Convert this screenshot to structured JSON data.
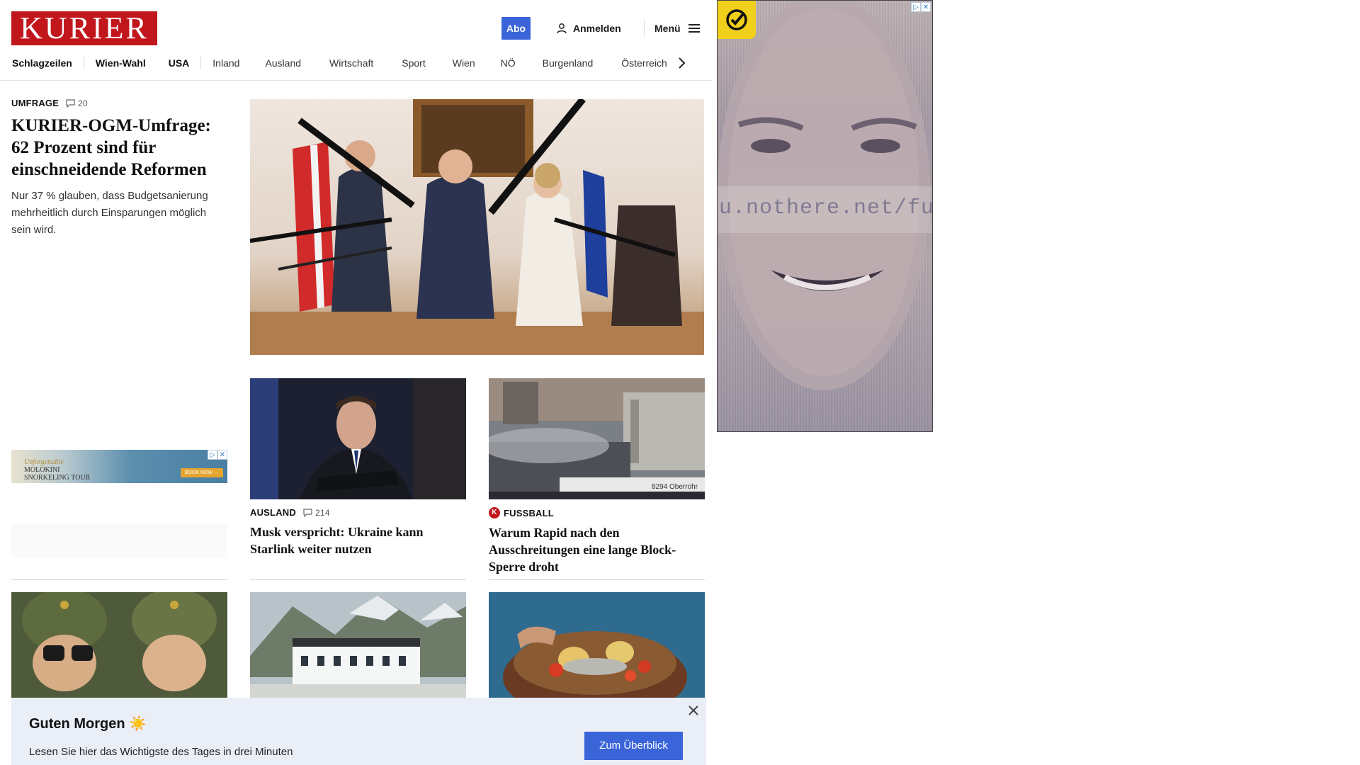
{
  "header": {
    "logo": "KURIER",
    "abo_label": "Abo",
    "login_label": "Anmelden",
    "menu_label": "Menü"
  },
  "nav": {
    "items": [
      "Schlagzeilen",
      "Wien-Wahl",
      "USA",
      "Inland",
      "Ausland",
      "Wirtschaft",
      "Sport",
      "Wien",
      "NÖ",
      "Burgenland",
      "Österreich"
    ]
  },
  "lead": {
    "kicker": "UMFRAGE",
    "comments": "20",
    "title": "KURIER-OGM-Umfrage: 62 Prozent sind für einschneidende Reformen",
    "teaser": "Nur 37 % glauben, dass Budgetsanierung mehrheitlich durch Einsparungen möglich sein wird."
  },
  "small_ad": {
    "line1": "Unforgettable",
    "line2": "MOLOKINI",
    "line3": "SNORKELING TOUR",
    "cta": "BOOK NOW →"
  },
  "cards": [
    {
      "kicker": "AUSLAND",
      "comments": "214",
      "title": "Musk verspricht: Ukraine kann Starlink weiter nutzen"
    },
    {
      "kicker": "FUSSBALL",
      "title": "Warum Rapid nach den Ausschreitungen eine lange Block-Sperre droht"
    }
  ],
  "side_ad": {
    "watermark": "u.nothere.net/fu"
  },
  "banner": {
    "title": "Guten Morgen ☀️",
    "text": "Lesen Sie hier das Wichtigste des Tages in drei Minuten",
    "cta": "Zum Überblick"
  },
  "colors": {
    "brand_red": "#c2161d",
    "accent_blue": "#3a64d8",
    "banner_bg": "#e9eef7"
  }
}
